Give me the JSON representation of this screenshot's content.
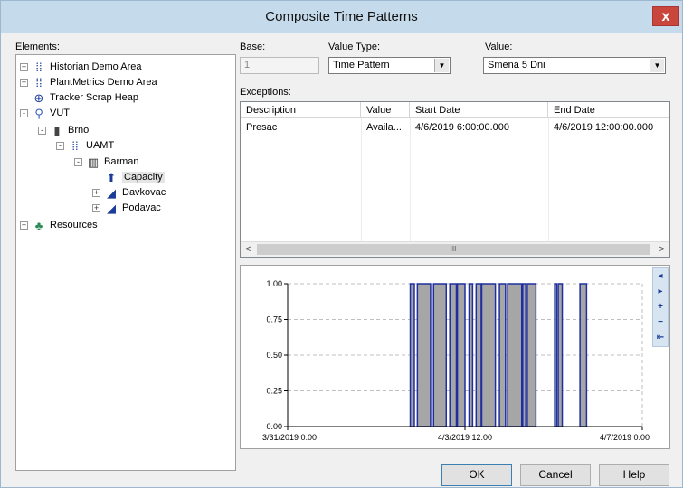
{
  "window": {
    "title": "Composite Time Patterns",
    "close_glyph": "x"
  },
  "labels": {
    "elements": "Elements:",
    "base": "Base:",
    "value_type": "Value Type:",
    "value": "Value:",
    "exceptions": "Exceptions:"
  },
  "fields": {
    "base_value": "1",
    "value_type_selected": "Time Pattern",
    "value_selected": "Smena 5 Dni"
  },
  "tree": [
    {
      "label": "Historian Demo Area",
      "icon": "area-icon",
      "expander": "+"
    },
    {
      "label": "PlantMetrics Demo Area",
      "icon": "area-icon",
      "expander": "+"
    },
    {
      "label": "Tracker Scrap Heap",
      "icon": "scrap-heap-icon",
      "expander": ""
    },
    {
      "label": "VUT",
      "icon": "site-icon",
      "expander": "-"
    },
    {
      "label": "Brno",
      "icon": "building-icon",
      "expander": "-"
    },
    {
      "label": "UAMT",
      "icon": "area-icon",
      "expander": "-"
    },
    {
      "label": "Barman",
      "icon": "line-icon",
      "expander": "-"
    },
    {
      "label": "Capacity",
      "icon": "capacity-icon",
      "expander": ""
    },
    {
      "label": "Davkovac",
      "icon": "machine-icon",
      "expander": "+"
    },
    {
      "label": "Podavac",
      "icon": "machine-icon",
      "expander": "+"
    },
    {
      "label": "Resources",
      "icon": "resources-icon",
      "expander": "+"
    }
  ],
  "exceptions": {
    "columns": [
      "Description",
      "Value",
      "Start Date",
      "End Date"
    ],
    "rows": [
      [
        "Presac",
        "Availa...",
        "4/6/2019 6:00:00.000",
        "4/6/2019 12:00:00.000"
      ]
    ],
    "scroll_thumb_glyph": "III",
    "scroll_left": "<",
    "scroll_right": ">"
  },
  "chart_tools": [
    "◂",
    "▸",
    "+",
    "−",
    "⇤"
  ],
  "chart_data": {
    "type": "bar",
    "y_ticks": [
      "1.00",
      "0.75",
      "0.50",
      "0.25",
      "0.00"
    ],
    "x_ticks": [
      "3/31/2019 0:00",
      "4/3/2019 12:00",
      "4/7/2019 0:00"
    ],
    "ylim": [
      0,
      1
    ],
    "x_range_days": [
      0,
      7
    ],
    "intervals": [
      {
        "start": 2.42,
        "end": 2.5,
        "value": 1
      },
      {
        "start": 2.56,
        "end": 2.82,
        "value": 1
      },
      {
        "start": 2.88,
        "end": 3.13,
        "value": 1
      },
      {
        "start": 3.2,
        "end": 3.33,
        "value": 1
      },
      {
        "start": 3.35,
        "end": 3.5,
        "value": 1
      },
      {
        "start": 3.58,
        "end": 3.65,
        "value": 1
      },
      {
        "start": 3.72,
        "end": 3.82,
        "value": 1
      },
      {
        "start": 3.83,
        "end": 4.1,
        "value": 1
      },
      {
        "start": 4.18,
        "end": 4.3,
        "value": 1
      },
      {
        "start": 4.34,
        "end": 4.62,
        "value": 1
      },
      {
        "start": 4.64,
        "end": 4.7,
        "value": 1
      },
      {
        "start": 4.73,
        "end": 4.9,
        "value": 1
      },
      {
        "start": 5.27,
        "end": 5.31,
        "value": 1
      },
      {
        "start": 5.34,
        "end": 5.42,
        "value": 1
      },
      {
        "start": 5.77,
        "end": 5.9,
        "value": 1
      }
    ],
    "colors": {
      "fill": "#a6a6a6",
      "edge": "#1f2f9f",
      "axis": "#000000",
      "grid": "#bfbfbf"
    }
  },
  "buttons": {
    "ok": "OK",
    "cancel": "Cancel",
    "help": "Help"
  }
}
